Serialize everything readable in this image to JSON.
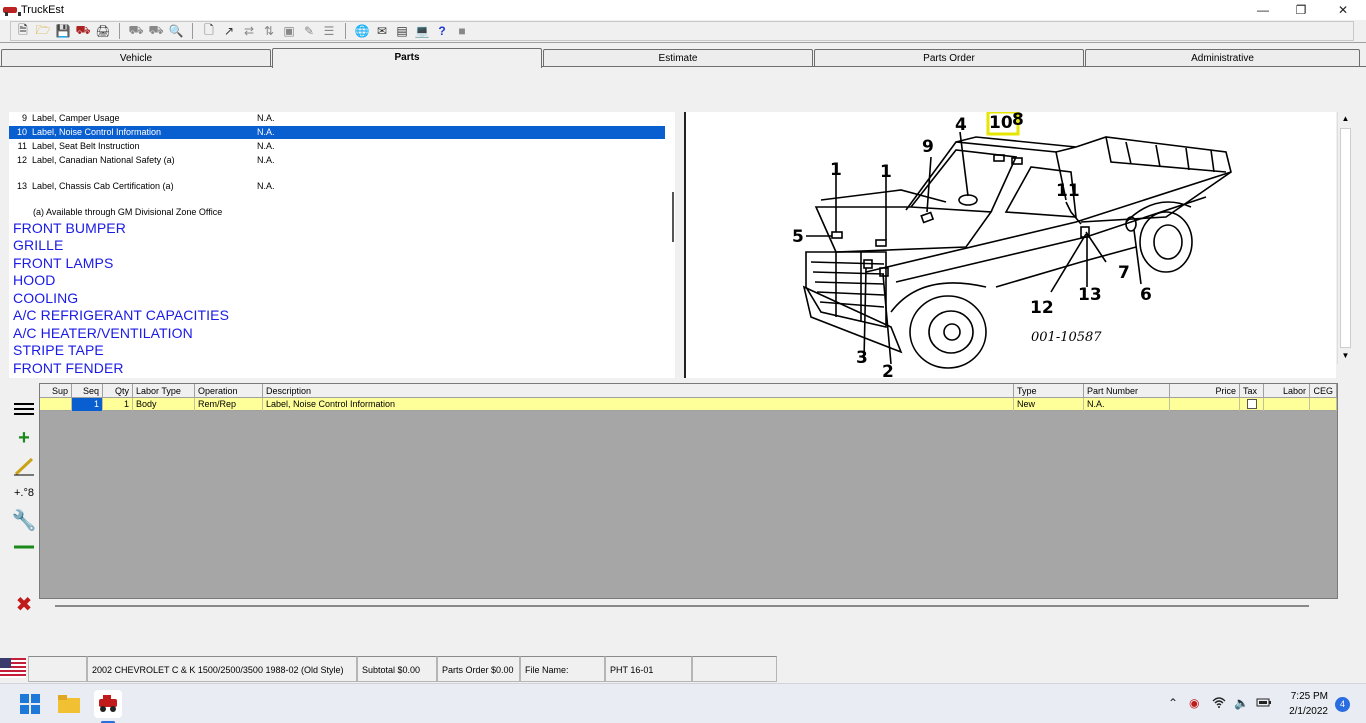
{
  "window": {
    "title": "TruckEst"
  },
  "tabs": [
    "Vehicle",
    "Parts",
    "Estimate",
    "Parts Order",
    "Administrative"
  ],
  "parts_list": [
    {
      "num": "9",
      "desc": "Label, Camper Usage",
      "pn": "N.A.",
      "selected": false
    },
    {
      "num": "10",
      "desc": "Label, Noise Control Information",
      "pn": "N.A.",
      "selected": true
    },
    {
      "num": "11",
      "desc": "Label, Seat Belt Instruction",
      "pn": "N.A.",
      "selected": false
    },
    {
      "num": "12",
      "desc": "Label, Canadian National Safety (a)",
      "pn": "N.A.",
      "selected": false
    },
    {
      "num": "13",
      "desc": "Label, Chassis Cab Certification (a)",
      "pn": "N.A.",
      "selected": false
    }
  ],
  "footnote": "(a) Available through GM Divisional Zone Office",
  "sections": [
    "FRONT BUMPER",
    "GRILLE",
    "FRONT LAMPS",
    "HOOD",
    "COOLING",
    "A/C REFRIGERANT CAPACITIES",
    "A/C HEATER/VENTILATION",
    "STRIPE TAPE",
    "FRONT FENDER"
  ],
  "diagram": {
    "callouts": [
      "1",
      "1",
      "2",
      "3",
      "4",
      "5",
      "6",
      "7",
      "8",
      "9",
      "10",
      "11",
      "12",
      "13"
    ],
    "figure_id": "001-10587"
  },
  "grid": {
    "headers": [
      "Sup",
      "Seq",
      "Qty",
      "Labor Type",
      "Operation",
      "Description",
      "Type",
      "Part Number",
      "Price",
      "Tax",
      "Labor",
      "CEG"
    ],
    "row": {
      "sup": "",
      "seq": "1",
      "qty": "1",
      "labor_type": "Body",
      "operation": "Rem/Rep",
      "description": "Label, Noise Control Information",
      "type": "New",
      "part_number": "N.A.",
      "price": "",
      "tax": false,
      "labor": "",
      "ceg": ""
    }
  },
  "statusbar": {
    "vehicle": "2002 CHEVROLET C & K 1500/2500/3500 1988-02 (Old Style)",
    "subtotal": "Subtotal $0.00",
    "parts_order": "Parts Order $0.00",
    "file_name": "File Name:",
    "code": "PHT 16-01"
  },
  "taskbar": {
    "time": "7:25 PM",
    "date": "2/1/2022",
    "notifications": "4"
  }
}
